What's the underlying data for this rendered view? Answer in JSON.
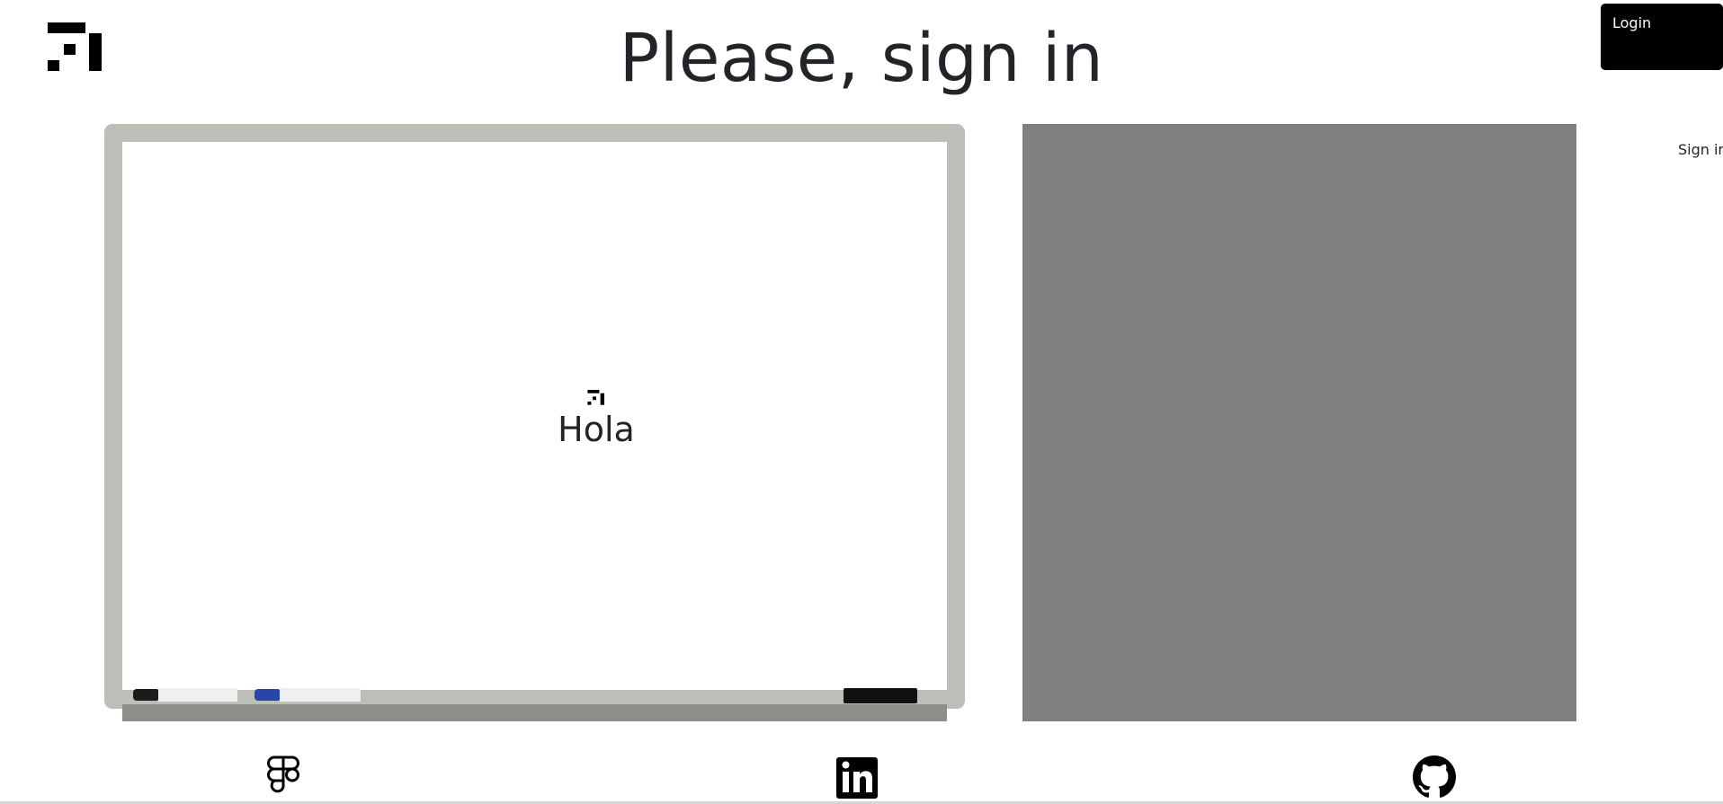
{
  "header": {
    "logo_icon": "brand-logo-icon",
    "title": "Please, sign in"
  },
  "auth": {
    "login_label": "Login",
    "sign_in_label": "Sign in"
  },
  "whiteboard": {
    "logo_icon": "brand-logo-icon",
    "text": "Hola",
    "markers": [
      {
        "name": "black-marker-icon",
        "color": "#1b1b1b"
      },
      {
        "name": "blue-marker-icon",
        "color": "#2a45a8"
      }
    ],
    "eraser_icon": "eraser-icon"
  },
  "side_panel": {
    "color": "#808080"
  },
  "footer": {
    "social": [
      {
        "name": "figma-icon"
      },
      {
        "name": "linkedin-icon"
      },
      {
        "name": "github-icon"
      }
    ]
  }
}
